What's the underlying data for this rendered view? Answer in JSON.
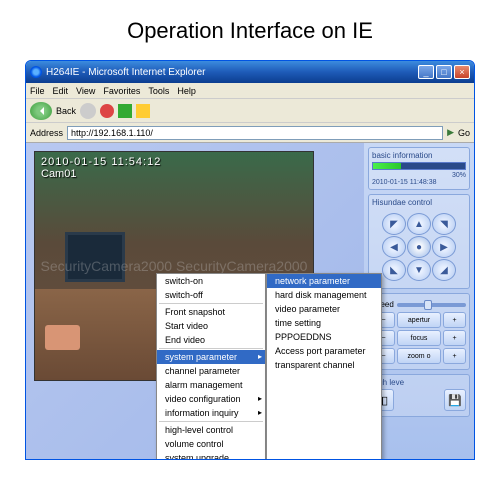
{
  "page_title": "Operation Interface on IE",
  "window": {
    "title": "H264IE - Microsoft Internet Explorer",
    "menus": [
      "File",
      "Edit",
      "View",
      "Favorites",
      "Tools",
      "Help"
    ],
    "back_label": "Back",
    "address_label": "Address",
    "url": "http://192.168.1.110/",
    "go_label": "Go"
  },
  "video": {
    "timestamp": "2010-01-15 11:54:12",
    "channel": "Cam01",
    "watermark": "SecurityCamera2000 SecurityCamera2000"
  },
  "context_menu": {
    "group1": [
      "switch-on",
      "switch-off"
    ],
    "group2": [
      "Front snapshot",
      "Start video",
      "End video"
    ],
    "group3": [
      "system parameter",
      "channel parameter",
      "alarm management",
      "video configuration",
      "information inquiry"
    ],
    "group4": [
      "high-level control",
      "volume control",
      "system upgrade"
    ],
    "selected": "system parameter",
    "submenu": [
      "network parameter",
      "hard disk management",
      "video parameter",
      "time setting",
      "PPPOEDDNS",
      "Access port parameter",
      "transparent channel"
    ],
    "sub_selected": "network parameter"
  },
  "sidebar": {
    "info_title": "basic information",
    "info_percent": "30%",
    "info_time": "2010-01-15  11:48:38",
    "ptz_title": "Hisundae control",
    "speed_label": "speed",
    "controls": {
      "aperture": "apertur",
      "focus": "focus",
      "zoom": "zoom o"
    },
    "high_level": "high leve"
  }
}
